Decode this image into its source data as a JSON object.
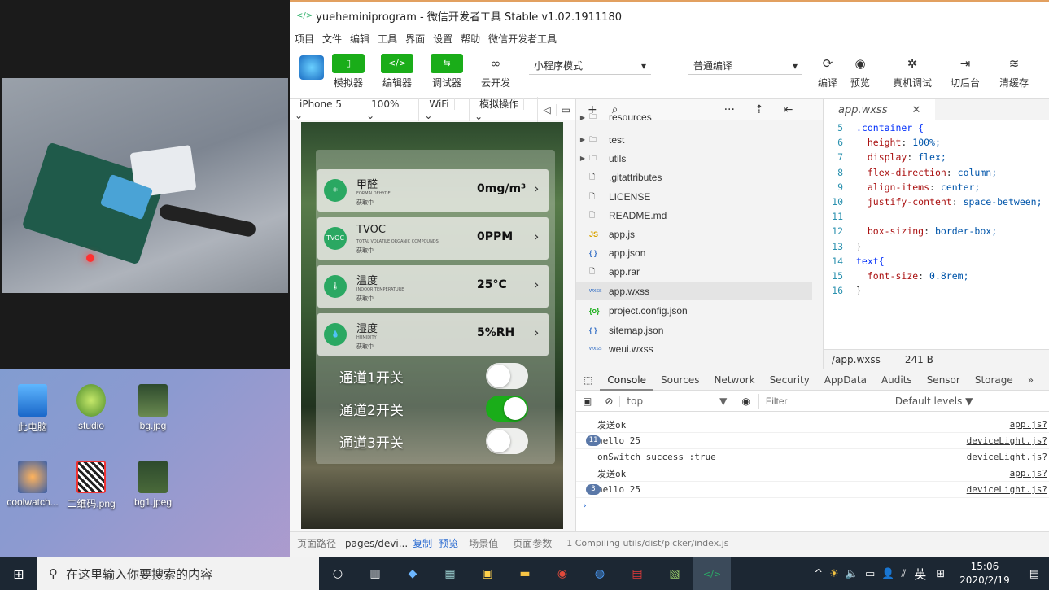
{
  "window": {
    "title": "yueheminiprogram - 微信开发者工具 Stable v1.02.1911180"
  },
  "menu": [
    "项目",
    "文件",
    "编辑",
    "工具",
    "界面",
    "设置",
    "帮助",
    "微信开发者工具"
  ],
  "toolbar": {
    "simulator": "模拟器",
    "editor": "编辑器",
    "debugger": "调试器",
    "cloud": "云开发",
    "mode": "小程序模式",
    "compile_mode": "普通编译",
    "compile": "编译",
    "preview": "预览",
    "remote_debug": "真机调试",
    "background": "切后台",
    "clear_cache": "清缓存"
  },
  "simbar": {
    "device": "iPhone 5",
    "zoom": "100%",
    "network": "WiFi",
    "operation": "模拟操作"
  },
  "sensors": [
    {
      "name": "甲醛",
      "sub": "FORMALDEHYDE",
      "status": "获取中",
      "value": "0mg/m³",
      "icon": "formaldehyde-icon"
    },
    {
      "name": "TVOC",
      "sub": "TOTAL VOLATILE ORGANIC COMPOUNDS",
      "status": "获取中",
      "value": "0PPM",
      "icon": "tvoc-icon"
    },
    {
      "name": "温度",
      "sub": "INDOOR TEMPERATURE",
      "status": "获取中",
      "value": "25°C",
      "icon": "thermometer-icon"
    },
    {
      "name": "湿度",
      "sub": "HUMIDITY",
      "status": "获取中",
      "value": "5%RH",
      "icon": "droplet-icon"
    }
  ],
  "switches": [
    {
      "label": "通道1开关",
      "on": false
    },
    {
      "label": "通道2开关",
      "on": true
    },
    {
      "label": "通道3开关",
      "on": false
    }
  ],
  "files": [
    {
      "name": "resources",
      "type": "folder"
    },
    {
      "name": "test",
      "type": "folder"
    },
    {
      "name": "utils",
      "type": "folder"
    },
    {
      "name": ".gitattributes",
      "type": "file"
    },
    {
      "name": "LICENSE",
      "type": "file"
    },
    {
      "name": "README.md",
      "type": "file"
    },
    {
      "name": "app.js",
      "type": "js"
    },
    {
      "name": "app.json",
      "type": "json"
    },
    {
      "name": "app.rar",
      "type": "file"
    },
    {
      "name": "app.wxss",
      "type": "wxss",
      "selected": true
    },
    {
      "name": "project.config.json",
      "type": "config"
    },
    {
      "name": "sitemap.json",
      "type": "json"
    },
    {
      "name": "weui.wxss",
      "type": "wxss"
    }
  ],
  "editor": {
    "tab": "app.wxss",
    "status_path": "/app.wxss",
    "status_size": "241 B",
    "lines": [
      {
        "n": "5",
        "text": ".container {"
      },
      {
        "n": "6",
        "text": "  height: 100%;"
      },
      {
        "n": "7",
        "text": "  display: flex;"
      },
      {
        "n": "8",
        "text": "  flex-direction: column;"
      },
      {
        "n": "9",
        "text": "  align-items: center;"
      },
      {
        "n": "10",
        "text": "  justify-content: space-between;"
      },
      {
        "n": "11",
        "text": ""
      },
      {
        "n": "12",
        "text": "  box-sizing: border-box;"
      },
      {
        "n": "13",
        "text": "}"
      },
      {
        "n": "14",
        "text": "text{"
      },
      {
        "n": "15",
        "text": "  font-size: 0.8rem;"
      },
      {
        "n": "16",
        "text": "}"
      }
    ]
  },
  "console": {
    "tabs": [
      "Console",
      "Sources",
      "Network",
      "Security",
      "AppData",
      "Audits",
      "Sensor",
      "Storage"
    ],
    "context": "top",
    "filter_placeholder": "Filter",
    "levels": "Default levels ▼",
    "rows": [
      {
        "count": "",
        "msg": "发送ok",
        "src": "app.js?"
      },
      {
        "count": "11",
        "msg": "hello 25",
        "src": "deviceLight.js?"
      },
      {
        "count": "",
        "msg": "onSwitch success :true",
        "src": "deviceLight.js?"
      },
      {
        "count": "",
        "msg": "发送ok",
        "src": "app.js?"
      },
      {
        "count": "3",
        "msg": "hello 25",
        "src": "deviceLight.js?"
      }
    ]
  },
  "status": {
    "path_label": "页面路径",
    "path": "pages/devi...",
    "copy": "复制",
    "preview": "预览",
    "scene": "场景值",
    "params": "页面参数",
    "compiling": "1 Compiling utils/dist/picker/index.js"
  },
  "desktop_icons": [
    "此电脑",
    "studio",
    "bg.jpg",
    "coolwatch...",
    "二维码.png",
    "bg1.jpeg"
  ],
  "taskbar": {
    "search_placeholder": "在这里输入你要搜索的内容",
    "ime": "英",
    "time": "15:06",
    "date": "2020/2/19"
  }
}
